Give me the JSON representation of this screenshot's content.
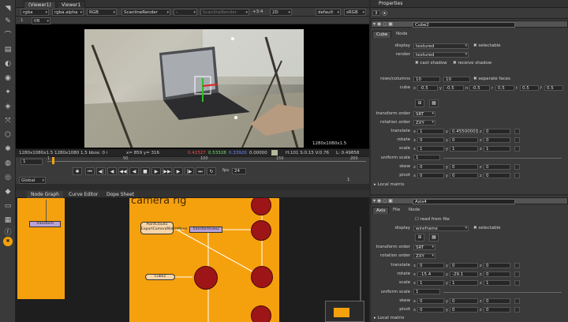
{
  "viewer": {
    "tabs": [
      "(Viewer1)",
      "Viewer1"
    ],
    "controls": {
      "layer": "rgba",
      "channel": "rgba.alpha",
      "colorspace": "RGB",
      "input_a": "ScanlineRender",
      "input_b": "-",
      "input_b2": "ScanlineRender",
      "gain": "+3.4",
      "mode": "2D",
      "roi": "default",
      "lut": "sRGB"
    },
    "row2": {
      "frame": "1",
      "zoom": "f/8"
    },
    "resolution": "1280x1080x1.5",
    "info": {
      "format": "1280x1080x1.5 1280x1080 1.5 bbox: 0 i",
      "xy": "x= 859 y= 316",
      "r": "0.42327",
      "g": "0.53328",
      "b": "0.33920",
      "a": "0.00000",
      "hsv": "H:101 S:0.15 V:0.76",
      "l": "L: 0.49858"
    },
    "timeline": {
      "frame": "1",
      "fps": "24",
      "global": "Global",
      "ticks": [
        "1",
        "50",
        "100",
        "150",
        "200"
      ],
      "end": "1"
    }
  },
  "nodegraph": {
    "tabs": [
      "Node Graph",
      "Curve Editor",
      "Dope Sheet"
    ],
    "backdrop_title": "camera rig",
    "nodes": {
      "transform_left": "Transform",
      "pointcloud": "PointCloud1\nExportCameraMatchMove",
      "transform_geo": "TransformGeo2",
      "cube": "Cube2"
    }
  },
  "properties": {
    "title": "Properties",
    "counter": "3",
    "panel1": {
      "name": "Cube2",
      "tabs": [
        "Cube",
        "Node"
      ],
      "display_label": "display",
      "display_value": "textured",
      "selectable": "selectable",
      "render_label": "render",
      "render_value": "textured",
      "cast_shadow": "cast shadow",
      "receive_shadow": "receive shadow",
      "rowcol_label": "rows/columns",
      "rows": "10",
      "columns": "10",
      "separate_faces": "separate faces",
      "cube_label": "cube",
      "cube_x": "-0.5",
      "cube_y": "-0.5",
      "cube_n": "-0.5",
      "cube_r": "0.5",
      "cube_t": "0.5",
      "cube_f": "0.5",
      "transform_order_label": "transform order",
      "transform_order": "SRT",
      "rotation_order_label": "rotation order",
      "rotation_order": "ZXY",
      "translate_label": "translate",
      "translate": [
        "1",
        "0.45500001",
        "0"
      ],
      "rotate_label": "rotate",
      "rotate": [
        "0",
        "0",
        "0"
      ],
      "scale_label": "scale",
      "scale": [
        "1",
        "1",
        "1"
      ],
      "uniform_scale_label": "uniform scale",
      "uniform_scale": "1",
      "skew_label": "skew",
      "skew": [
        "0",
        "0",
        "0"
      ],
      "pivot_label": "pivot",
      "pivot": [
        "0",
        "0",
        "0"
      ],
      "local_matrix": "Local matrix"
    },
    "panel2": {
      "name": "Axis4",
      "tabs": [
        "Axis",
        "File",
        "Node"
      ],
      "read_from_file": "read from file",
      "display_label": "display",
      "display_value": "wireframe",
      "selectable": "selectable",
      "transform_order_label": "transform order",
      "transform_order": "SRT",
      "rotation_order_label": "rotation order",
      "rotation_order": "ZXY",
      "translate_label": "translate",
      "translate": [
        "0",
        "0",
        "0"
      ],
      "rotate_label": "rotate",
      "rotate": [
        "-15.4",
        "-29.1",
        "0"
      ],
      "scale_label": "scale",
      "scale": [
        "1",
        "1",
        "1"
      ],
      "uniform_scale_label": "uniform scale",
      "uniform_scale": "1",
      "skew_label": "skew",
      "skew": [
        "0",
        "0",
        "0"
      ],
      "pivot_label": "pivot",
      "pivot": [
        "0",
        "0",
        "0"
      ],
      "local_matrix": "Local matrix"
    }
  },
  "axis_letters": {
    "x": "x",
    "y": "y",
    "z": "z",
    "n": "n",
    "r": "r",
    "t": "t",
    "f": "f"
  },
  "colors": {
    "accent_orange": "#f5a10e",
    "node_red": "#9e1518",
    "node_purple": "#b9a2d6",
    "red_value": "#ff4a4a",
    "green_value": "#6ee26e",
    "blue_value": "#6f8cff"
  },
  "icons": {
    "toolbar": [
      "pointer-icon",
      "paint-icon",
      "draw-icon",
      "channel-icon",
      "color-icon",
      "filter-icon",
      "keyer-icon",
      "merge-icon",
      "transform-icon",
      "3d-icon",
      "particles-icon",
      "deep-icon",
      "views-icon",
      "metadata-icon",
      "toolsets-icon",
      "other-icon",
      "furnace-icon",
      "nuke-logo-icon"
    ]
  }
}
